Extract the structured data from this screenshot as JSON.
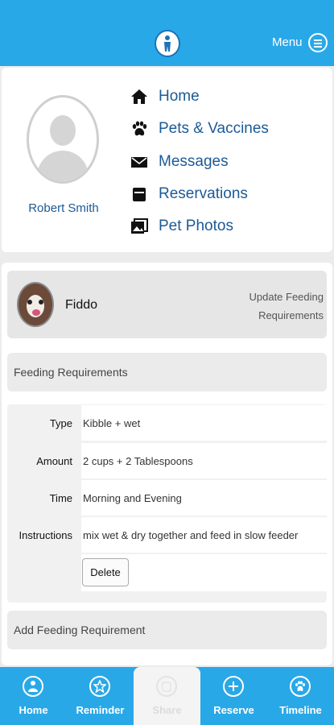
{
  "header": {
    "logo_icon": "pet-logo-icon",
    "menu_label": "Menu",
    "accent_color": "#29a8e8"
  },
  "profile": {
    "user_name": "Robert Smith",
    "nav": [
      {
        "label": "Home",
        "icon": "house-icon"
      },
      {
        "label": "Pets & Vaccines",
        "icon": "paw-icon"
      },
      {
        "label": "Messages",
        "icon": "envelope-icon"
      },
      {
        "label": "Reservations",
        "icon": "calendar-icon"
      },
      {
        "label": "Pet Photos",
        "icon": "photos-icon"
      }
    ]
  },
  "pet": {
    "name": "Fiddo",
    "update_link": "Update Feeding Requirements"
  },
  "feeding": {
    "section_title": "Feeding Requirements",
    "rows": [
      {
        "key": "Type",
        "value": "Kibble + wet"
      },
      {
        "key": "Amount",
        "value": "2 cups + 2 Tablespoons"
      },
      {
        "key": "Time",
        "value": "Morning and Evening"
      },
      {
        "key": "Instructions",
        "value": "mix wet & dry together and feed in slow feeder"
      }
    ],
    "delete_label": "Delete",
    "add_label": "Add Feeding Requirement"
  },
  "tabbar": {
    "tabs": [
      {
        "label": "Home",
        "icon": "home-circle-icon"
      },
      {
        "label": "Reminder",
        "icon": "star-icon"
      },
      {
        "label": "Share",
        "icon": "share-icon"
      },
      {
        "label": "Reserve",
        "icon": "plus-icon"
      },
      {
        "label": "Timeline",
        "icon": "paw-circle-icon"
      }
    ]
  }
}
